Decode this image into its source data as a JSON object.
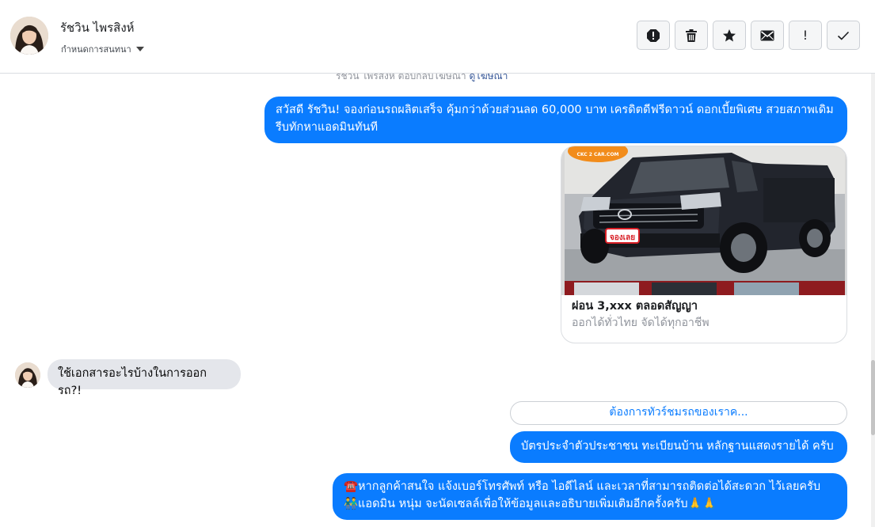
{
  "header": {
    "contact_name": "รัชวิน ไพรสิงห์",
    "assign_label": "กำหนดการสนทนา",
    "actions": [
      "mark-spam-icon",
      "trash-icon",
      "star-icon",
      "envelope-icon",
      "exclamation-icon",
      "check-icon"
    ],
    "action_labels": {
      "important": "!"
    }
  },
  "thread": {
    "system_note": "รัชวิน ไพรสิงห์ ตอบกลับโฆษณา",
    "system_note_link": "ดูโฆษณา",
    "messages": [
      {
        "side": "out",
        "text": "สวัสดี รัชวิน! จองก่อนรถผลิตเสร็จ คุ้มกว่าด้วยส่วนลด 60,000 บาท เครดิตดีฟรีดาวน์ ดอกเบี้ยพิเศษ สวยสภาพเดิม รีบทักหาแอดมินทันที"
      },
      {
        "side": "in",
        "text": "ใช้เอกสารอะไรบ้างในการออกรถ?!"
      },
      {
        "side": "out",
        "text": "บัตรประจำตัวประชาชน ทะเบียนบ้าน หลักฐานแสดงรายได้ ครับ"
      },
      {
        "side": "out",
        "text": "☎️หากลูกค้าสนใจ แจ้งเบอร์โทรศัพท์ หรือ ไอดีไลน์ และเวลาที่สามารถติดต่อได้สะดวก ไว้เลยครับ 👬แอดมิน หนุ่ม จะนัดเซลล์เพื่อให้ข้อมูลและอธิบายเพิ่มเติมอีกครั้งครับ🙏🙏"
      }
    ],
    "card": {
      "badge_text": "CKC 2 CAR.COM",
      "sticker_text": "จองเลย",
      "title": "ผ่อน 3,xxx ตลอดสัญญา",
      "subtitle": "ออกได้ทั่วไทย จัดได้ทุกอาชีพ"
    },
    "quick_reply": "ต้องการทัวร์ชมรถของเราค..."
  },
  "colors": {
    "accent": "#0a7cff",
    "incoming_bubble": "#e4e6eb",
    "border": "#dadde1"
  }
}
